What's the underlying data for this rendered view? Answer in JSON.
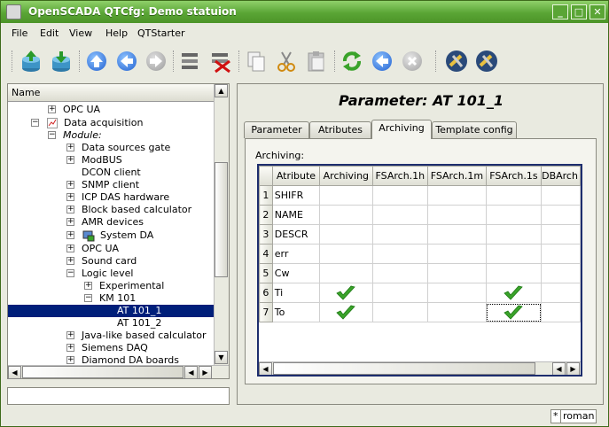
{
  "window": {
    "title": "OpenSCADA QTCfg: Demo statuion"
  },
  "menu": [
    "File",
    "Edit",
    "View",
    "Help",
    "QTStarter"
  ],
  "toolbar": {
    "icons": [
      "db-load-icon",
      "db-save-icon",
      "up-icon",
      "back-icon",
      "forward-icon",
      "add-item-icon",
      "delete-item-icon",
      "copy-icon",
      "cut-icon",
      "paste-icon",
      "refresh-icon",
      "start-icon",
      "stop-icon",
      "tool-settings-icon",
      "tool-calc-icon"
    ]
  },
  "tree": {
    "header": "Name",
    "items": [
      {
        "label": "OPC UA",
        "expander": "+"
      },
      {
        "label": "Data acquisition",
        "expander": "−"
      },
      {
        "label": "Module:",
        "expander": "−"
      },
      {
        "label": "Data sources gate",
        "expander": "+"
      },
      {
        "label": "ModBUS",
        "expander": "+"
      },
      {
        "label": "DCON client",
        "expander": ""
      },
      {
        "label": "SNMP client",
        "expander": "+"
      },
      {
        "label": "ICP DAS hardware",
        "expander": "+"
      },
      {
        "label": "Block based calculator",
        "expander": "+"
      },
      {
        "label": "AMR devices",
        "expander": "+"
      },
      {
        "label": "System DA",
        "expander": "+"
      },
      {
        "label": "OPC UA",
        "expander": "+"
      },
      {
        "label": "Sound card",
        "expander": "+"
      },
      {
        "label": "Logic level",
        "expander": "−"
      },
      {
        "label": "Experimental",
        "expander": "+"
      },
      {
        "label": "KM 101",
        "expander": "−"
      },
      {
        "label": "AT 101_1",
        "expander": ""
      },
      {
        "label": "AT 101_2",
        "expander": ""
      },
      {
        "label": "Java-like based calculator",
        "expander": "+"
      },
      {
        "label": "Siemens DAQ",
        "expander": "+"
      },
      {
        "label": "Diamond DA boards",
        "expander": "+"
      }
    ]
  },
  "page": {
    "title": "Parameter: AT 101_1",
    "tabs": [
      "Parameter",
      "Atributes",
      "Archiving",
      "Template config"
    ],
    "active_tab": "Archiving",
    "group_label": "Archiving:",
    "table": {
      "columns": [
        "Atribute",
        "Archiving",
        "FSArch.1h",
        "FSArch.1m",
        "FSArch.1s",
        "DBArch"
      ],
      "rows": [
        {
          "num": "1",
          "name": "SHIFR",
          "archiving": false,
          "fs1s": false
        },
        {
          "num": "2",
          "name": "NAME",
          "archiving": false,
          "fs1s": false
        },
        {
          "num": "3",
          "name": "DESCR",
          "archiving": false,
          "fs1s": false
        },
        {
          "num": "4",
          "name": "err",
          "archiving": false,
          "fs1s": false
        },
        {
          "num": "5",
          "name": "Cw",
          "archiving": false,
          "fs1s": false
        },
        {
          "num": "6",
          "name": "Ti",
          "archiving": true,
          "fs1s": true
        },
        {
          "num": "7",
          "name": "To",
          "archiving": true,
          "fs1s": true
        }
      ]
    }
  },
  "status": {
    "indicator": "*",
    "user": "roman"
  },
  "colors": {
    "titlebar": "#5aa535",
    "selection": "#001f7a",
    "check": "#3aa32a"
  }
}
